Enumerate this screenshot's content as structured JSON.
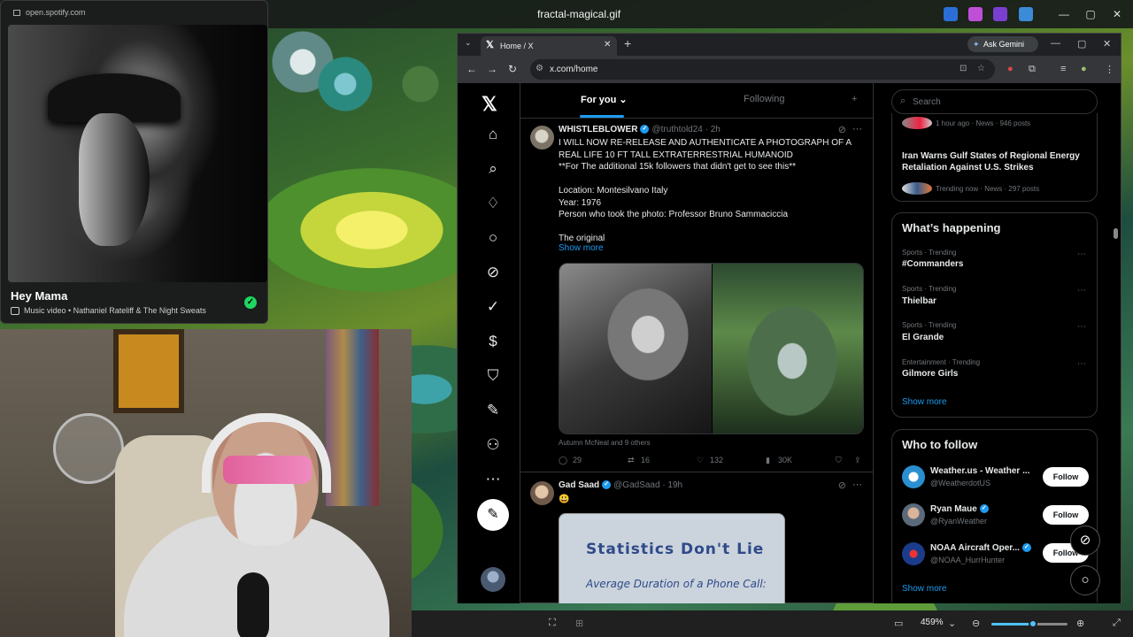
{
  "window": {
    "title": "fractal-magical.gif",
    "min": "—",
    "max": "▢",
    "close": "✕"
  },
  "spotify": {
    "url": "open.spotify.com",
    "title": "Hey Mama",
    "subtitle": "Music video • Nathaniel Rateliff & The Night Sweats",
    "check": "✓"
  },
  "browser": {
    "tab_label": "Home / X",
    "tab_close": "✕",
    "new_tab": "+",
    "tab_search": "⌄",
    "gemini": "Ask Gemini",
    "url": "x.com/home",
    "win_min": "—",
    "win_max": "▢",
    "win_close": "✕"
  },
  "x": {
    "logo": "𝕏",
    "nav": [
      "home-icon",
      "explore-icon",
      "notifications-icon",
      "messages-icon",
      "grok-icon",
      "verified-icon",
      "premium-icon",
      "bookmarks-icon",
      "lists-icon",
      "profile-icon",
      "more-icon"
    ],
    "tabs": {
      "for_you": "For you ⌄",
      "following": "Following",
      "plus": "+"
    },
    "tweets": [
      {
        "name": "WHISTLEBLOWER",
        "handle": "@truthtold24 · 2h",
        "body": "I WILL NOW RE-RELEASE AND AUTHENTICATE A PHOTOGRAPH OF A REAL LIFE 10 FT TALL EXTRATERRESTRIAL HUMANOID\n**For The additional 15k followers that didn't get to see this**\n\nLocation: Montesilvano Italy\nYear: 1976\nPerson who took the photo: Professor Bruno Sammaciccia\n\nThe original",
        "show_more": "Show more",
        "tagged": "Autumn McNeal and 9 others",
        "replies": "29",
        "reposts": "16",
        "likes": "132",
        "views": "30K"
      },
      {
        "name": "Gad Saad",
        "handle": "@GadSaad · 19h",
        "body": "😃",
        "image_title": "Statistics Don't Lie",
        "image_sub": "Average Duration of a Phone Call:"
      }
    ]
  },
  "sidebar": {
    "search_placeholder": "Search",
    "news": [
      {
        "meta": "1 hour ago · News · 946 posts"
      },
      {
        "headline": "Iran Warns Gulf States of Regional Energy Retaliation Against U.S. Strikes",
        "meta": "Trending now · News · 297 posts"
      }
    ],
    "happening": {
      "title": "What’s happening",
      "trends": [
        {
          "meta": "Sports · Trending",
          "name": "#Commanders"
        },
        {
          "meta": "Sports · Trending",
          "name": "Thielbar"
        },
        {
          "meta": "Sports · Trending",
          "name": "El Grande"
        },
        {
          "meta": "Entertainment · Trending",
          "name": "Gilmore Girls"
        }
      ],
      "show_more": "Show more"
    },
    "follow": {
      "title": "Who to follow",
      "accounts": [
        {
          "name": "Weather.us - Weather ...",
          "handle": "@WeatherdotUS",
          "button": "Follow"
        },
        {
          "name": "Ryan Maue",
          "handle": "@RyanWeather",
          "button": "Follow"
        },
        {
          "name": "NOAA Aircraft Oper...",
          "handle": "@NOAA_HurrHunter",
          "button": "Follow"
        }
      ],
      "show_more": "Show more"
    }
  },
  "viewer": {
    "zoom": "459%",
    "zoom_fraction": 0.55
  }
}
